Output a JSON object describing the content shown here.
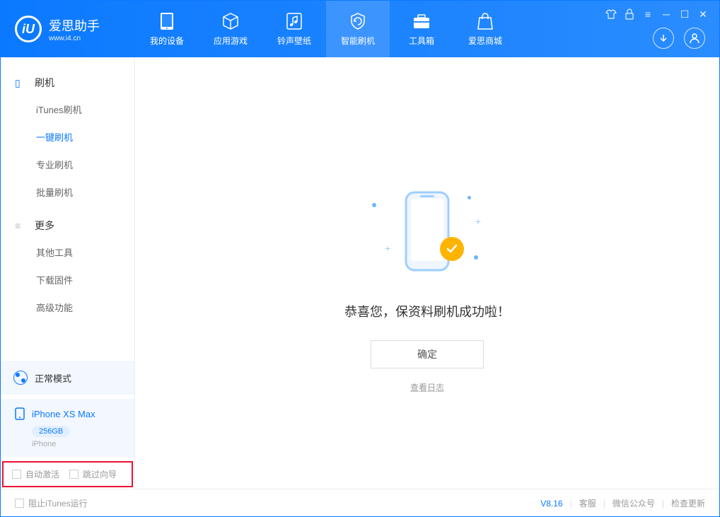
{
  "app": {
    "title": "爱思助手",
    "subtitle": "www.i4.cn"
  },
  "nav": [
    {
      "label": "我的设备"
    },
    {
      "label": "应用游戏"
    },
    {
      "label": "铃声壁纸"
    },
    {
      "label": "智能刷机"
    },
    {
      "label": "工具箱"
    },
    {
      "label": "爱思商城"
    }
  ],
  "sidebar": {
    "section1": {
      "title": "刷机",
      "items": [
        "iTunes刷机",
        "一键刷机",
        "专业刷机",
        "批量刷机"
      ]
    },
    "section2": {
      "title": "更多",
      "items": [
        "其他工具",
        "下载固件",
        "高级功能"
      ]
    },
    "mode": "正常模式",
    "device": {
      "name": "iPhone XS Max",
      "capacity": "256GB",
      "type": "iPhone"
    },
    "checks": {
      "auto_activate": "自动激活",
      "skip_guide": "跳过向导"
    }
  },
  "main": {
    "success": "恭喜您，保资料刷机成功啦！",
    "ok": "确定",
    "view_log": "查看日志"
  },
  "footer": {
    "block_itunes": "阻止iTunes运行",
    "version": "V8.16",
    "service": "客服",
    "wechat": "微信公众号",
    "update": "检查更新"
  }
}
